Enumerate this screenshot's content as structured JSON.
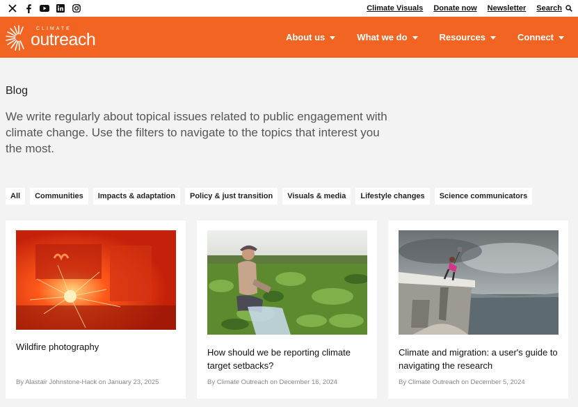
{
  "social": {
    "icons": [
      "x-icon",
      "facebook-icon",
      "youtube-icon",
      "linkedin-icon",
      "instagram-icon"
    ]
  },
  "utility": {
    "links": [
      "Climate Visuals",
      "Donate now",
      "Newsletter"
    ],
    "search_label": "Search"
  },
  "brand": {
    "small": "CLIMATE",
    "big": "outreach",
    "color": "#f26422"
  },
  "nav": {
    "items": [
      "About us",
      "What we do",
      "Resources",
      "Connect"
    ]
  },
  "intro": {
    "title": "Blog",
    "description": "We write regularly about topical issues related to public engagement with climate change. Use the filters to navigate to the topics that interest you the most."
  },
  "filters": [
    "All",
    "Communities",
    "Impacts & adaptation",
    "Policy & just transition",
    "Visuals & media",
    "Lifestyle changes",
    "Science communicators"
  ],
  "cards": [
    {
      "title": "Wildfire photography",
      "meta": "By Alastair Johnstone-Hack on January 23, 2025",
      "image": "wildfire-photo"
    },
    {
      "title": "How should we be reporting climate target setbacks?",
      "meta": "By Climate Outreach on December 16, 2024",
      "image": "farmer-field-photo"
    },
    {
      "title": "Climate and migration: a user's guide to navigating the research",
      "meta": "By Climate Outreach on December 5, 2024",
      "image": "coastal-ruins-photo"
    }
  ]
}
